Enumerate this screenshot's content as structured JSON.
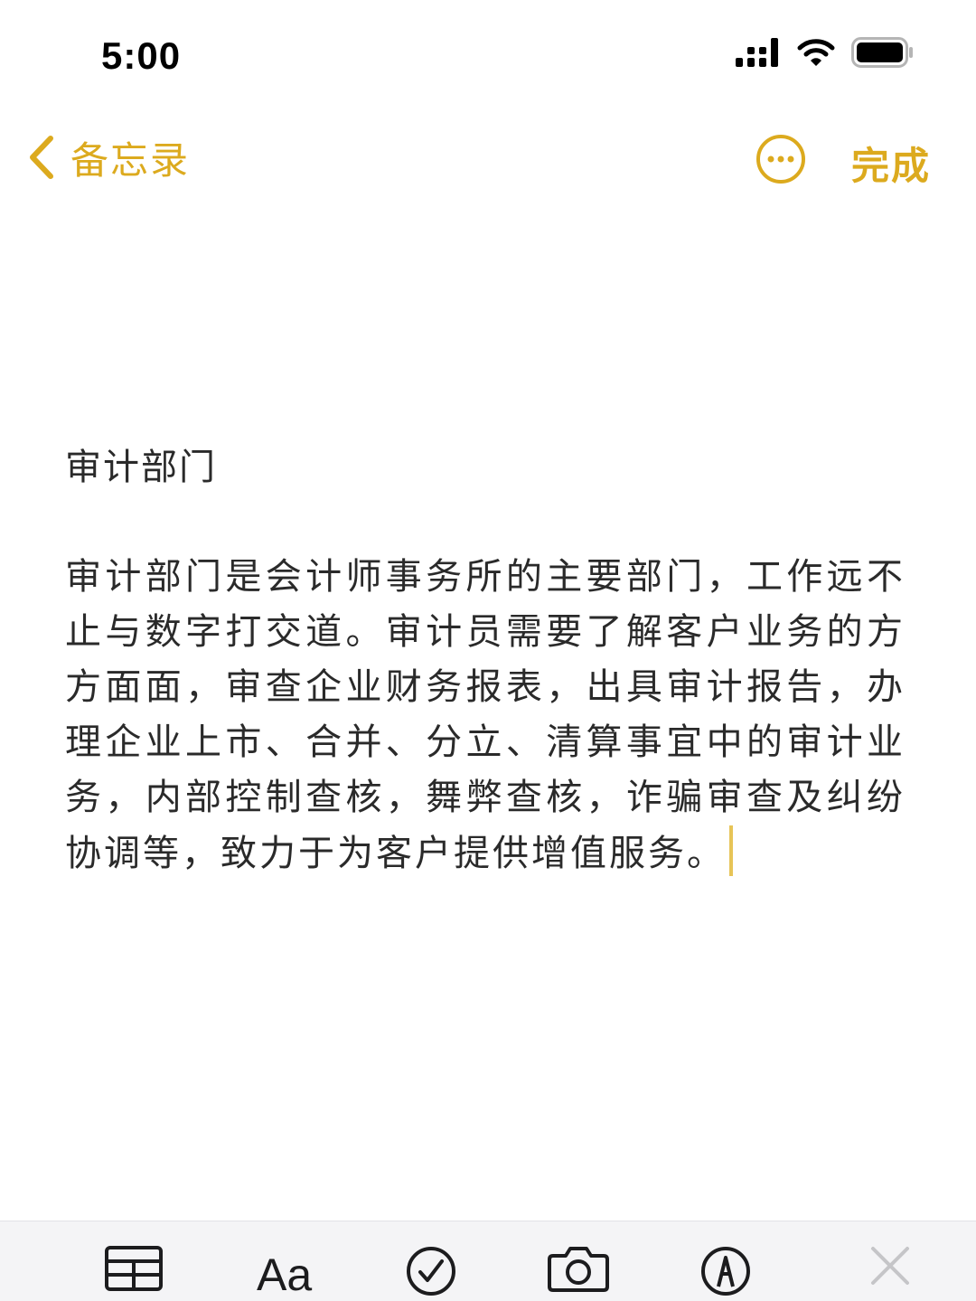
{
  "status_bar": {
    "time": "5:00"
  },
  "nav": {
    "back_label": "备忘录",
    "done_label": "完成"
  },
  "note": {
    "title": "审计部门",
    "body": "审计部门是会计师事务所的主要部门，工作远不止与数字打交道。审计员需要了解客户业务的方方面面，审查企业财务报表，出具审计报告，办理企业上市、合并、分立、清算事宜中的审计业务，内部控制查核，舞弊查核，诈骗审查及纠纷协调等，致力于为客户提供增值服务。"
  },
  "toolbar": {
    "format_label": "Aa",
    "icons": [
      "table-icon",
      "text-format-icon",
      "checklist-icon",
      "camera-icon",
      "markup-icon",
      "close-icon"
    ]
  },
  "colors": {
    "accent": "#dcaa1e",
    "text": "#2a2a2a",
    "toolbar_bg": "#f4f4f6",
    "cursor": "#e7c457"
  }
}
